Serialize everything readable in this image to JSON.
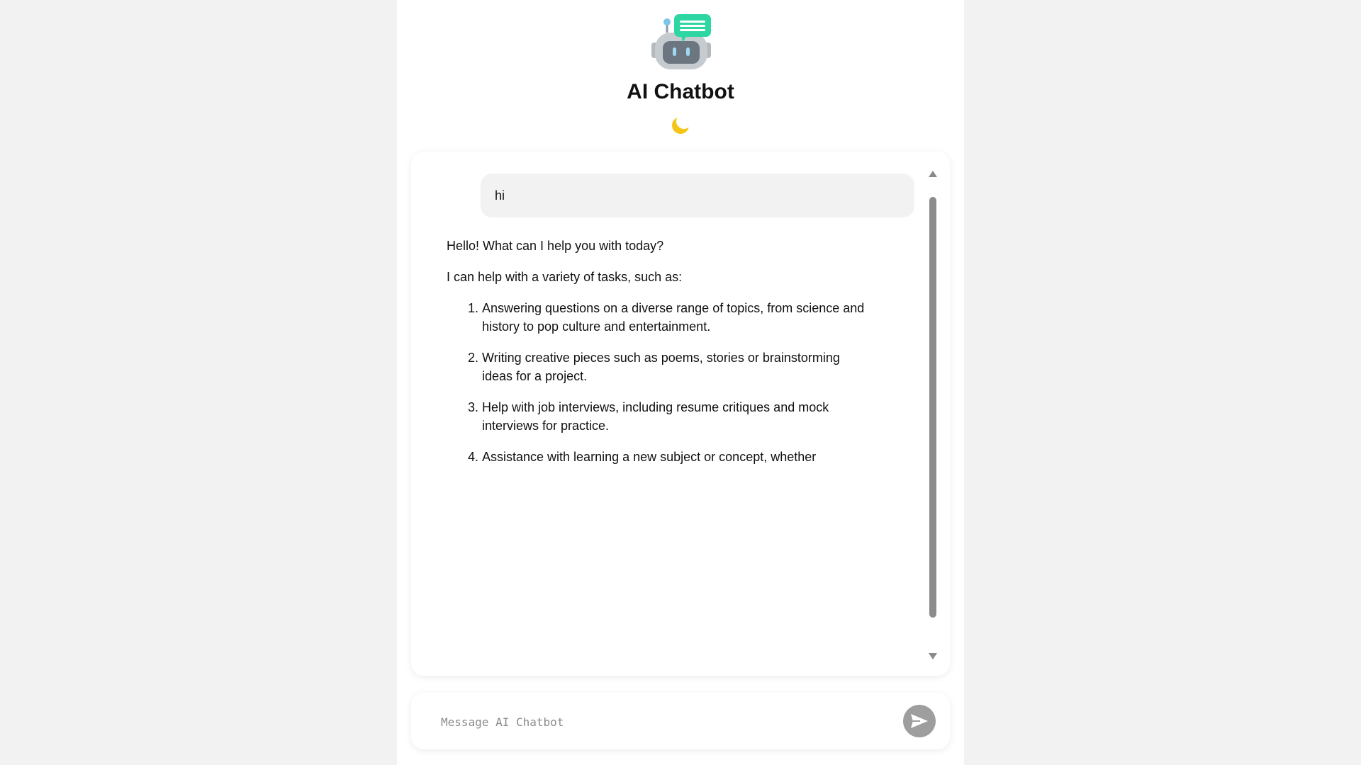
{
  "header": {
    "title": "AI Chatbot",
    "logo_icon": "robot-chat-icon",
    "theme_toggle_icon": "crescent-moon-icon",
    "theme_toggle_glyph": "🌙"
  },
  "conversation": {
    "user_message": "hi",
    "bot_intro": "Hello! What can I help you with today?",
    "bot_lead": "I can help with a variety of tasks, such as:",
    "bot_items": [
      "Answering questions on a diverse range of topics, from science and history to pop culture and entertainment.",
      "Writing creative pieces such as poems, stories or brainstorming ideas for a project.",
      "Help with job interviews, including resume critiques and mock interviews for practice.",
      "Assistance with learning a new subject or concept, whether"
    ]
  },
  "composer": {
    "placeholder": "Message AI Chatbot",
    "value": "",
    "send_icon": "send-arrow-icon"
  },
  "colors": {
    "page_background": "#f2f2f2",
    "panel_background": "#ffffff",
    "user_bubble": "#f2f2f2",
    "send_button": "#9e9e9e",
    "scrollbar_thumb": "#8c8c8c",
    "logo_accent": "#2ed6a3"
  }
}
